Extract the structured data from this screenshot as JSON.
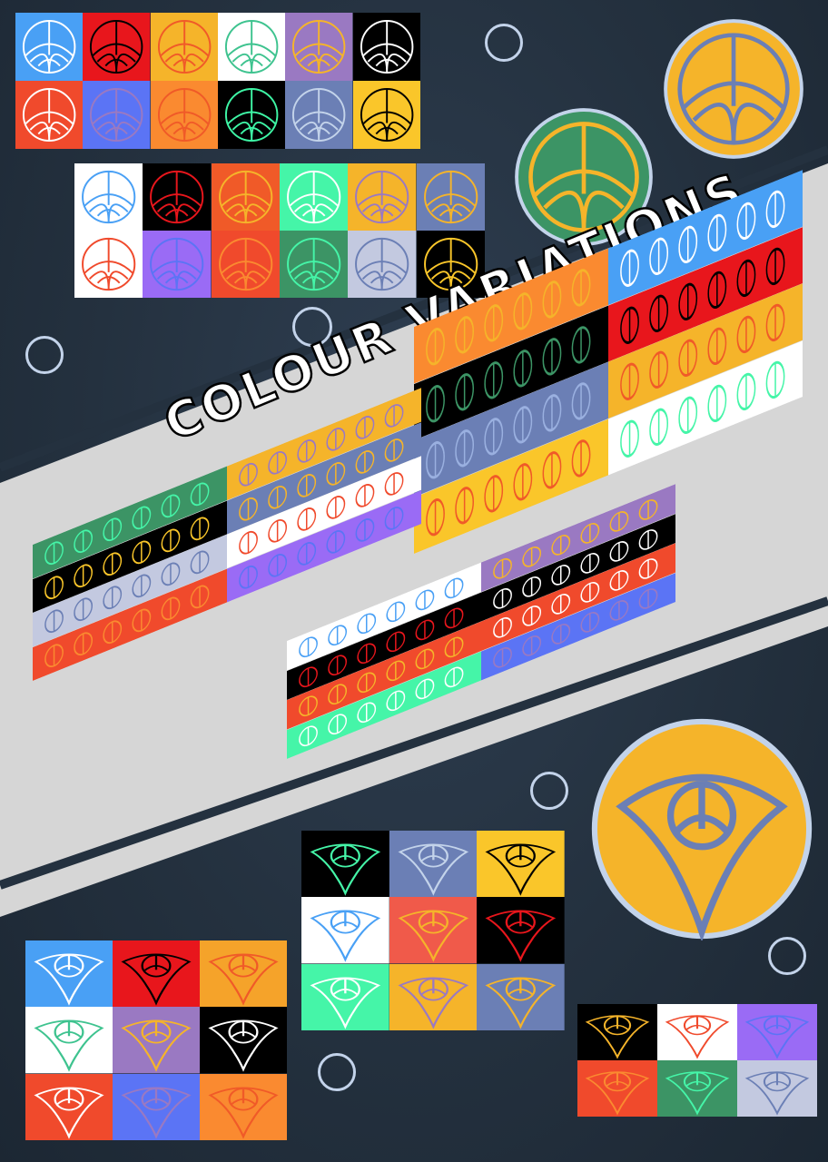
{
  "title": "COLOUR VARIATIONS",
  "colors": {
    "background": "#24313f",
    "diagonal_band": "#d6d6d6",
    "stripe": "#ffffff",
    "ring_outline": "#c3d3ea"
  },
  "icon_names": {
    "emblem": "peace-arch-emblem-icon",
    "fan": "fan-emblem-icon",
    "wordmark": "stylized-wordmark"
  },
  "circle_emblems": [
    {
      "fill": "#3c9465",
      "line": "#f5b42a",
      "border": "#c3d3ea"
    },
    {
      "fill": "#f5b42a",
      "line": "#6b7fb5",
      "border": "#c3d3ea"
    },
    {
      "fill": "#f5b42a",
      "line": "#6b7fb5",
      "border": "#c3d3ea"
    }
  ],
  "emblem_grid_top": [
    [
      "#49a0f5",
      "#ffffff"
    ],
    [
      "#e8161c",
      "#000000"
    ],
    [
      "#f5b42a",
      "#f05a28"
    ],
    [
      "#ffffff",
      "#3ec38f"
    ],
    [
      "#9a79c2",
      "#f5b42a"
    ],
    [
      "#000000",
      "#ffffff"
    ],
    [
      "#f04a2c",
      "#ffffff"
    ],
    [
      "#5b74f5",
      "#9a79c2"
    ],
    [
      "#fa8a30",
      "#f05a28"
    ],
    [
      "#000000",
      "#3ef5a5"
    ],
    [
      "#6b7fb5",
      "#c3d3ea"
    ],
    [
      "#fac62a",
      "#000000"
    ]
  ],
  "emblem_grid_second": [
    [
      "#ffffff",
      "#49a0f5"
    ],
    [
      "#000000",
      "#e8161c"
    ],
    [
      "#f05a28",
      "#f5b42a"
    ],
    [
      "#45f5a8",
      "#ffffff"
    ],
    [
      "#f5b42a",
      "#9a79c2"
    ],
    [
      "#6b7fb5",
      "#f5b42a"
    ],
    [
      "#ffffff",
      "#f04a2c"
    ],
    [
      "#9a6bf5",
      "#5b74f5"
    ],
    [
      "#f04a2c",
      "#fa8a30"
    ],
    [
      "#3c9465",
      "#45f5a8"
    ],
    [
      "#c3c9e0",
      "#6b7fb5"
    ],
    [
      "#000000",
      "#fac62a"
    ]
  ],
  "fan_grid_center": [
    [
      "#000000",
      "#45f5a8"
    ],
    [
      "#6b7fb5",
      "#c3d3ea"
    ],
    [
      "#fac62a",
      "#000000"
    ],
    [
      "#ffffff",
      "#49a0f5"
    ],
    [
      "#f05a4a",
      "#f5b42a"
    ],
    [
      "#000000",
      "#e8161c"
    ],
    [
      "#45f5a8",
      "#ffffff"
    ],
    [
      "#f5b42a",
      "#9a79c2"
    ],
    [
      "#6b7fb5",
      "#f5b42a"
    ]
  ],
  "fan_grid_left": [
    [
      "#49a0f5",
      "#ffffff"
    ],
    [
      "#e8161c",
      "#000000"
    ],
    [
      "#f5a32a",
      "#f05a28"
    ],
    [
      "#ffffff",
      "#3ec38f"
    ],
    [
      "#9a79c2",
      "#f5b42a"
    ],
    [
      "#000000",
      "#ffffff"
    ],
    [
      "#f04a2c",
      "#ffffff"
    ],
    [
      "#5b74f5",
      "#9a79c2"
    ],
    [
      "#fa8a30",
      "#f05a28"
    ]
  ],
  "fan_grid_right": [
    [
      "#000000",
      "#f5b42a"
    ],
    [
      "#ffffff",
      "#f04a2c"
    ],
    [
      "#9a6bf5",
      "#5b74f5"
    ],
    [
      "#f04a2c",
      "#fa8a30"
    ],
    [
      "#3c9465",
      "#45f5a8"
    ],
    [
      "#c3c9e0",
      "#6b7fb5"
    ]
  ],
  "wordmark_blocks": [
    {
      "strips": [
        [
          "#fa8a30",
          "#f5b42a"
        ],
        [
          "#000000",
          "#3c9465"
        ],
        [
          "#6b7fb5",
          "#9ab0e0"
        ],
        [
          "#fac62a",
          "#f05a28"
        ],
        [
          "#49a0f5",
          "#ffffff"
        ],
        [
          "#e8161c",
          "#000000"
        ],
        [
          "#f5b42a",
          "#f05a28"
        ],
        [
          "#ffffff",
          "#45f5a8"
        ]
      ]
    },
    {
      "strips": [
        [
          "#3c9465",
          "#45f5a8"
        ],
        [
          "#000000",
          "#fac62a"
        ],
        [
          "#c3c9e0",
          "#6b7fb5"
        ],
        [
          "#f04a2c",
          "#fa8a30"
        ],
        [
          "#f5b42a",
          "#9a79c2"
        ],
        [
          "#6b7fb5",
          "#f5b42a"
        ],
        [
          "#ffffff",
          "#f04a2c"
        ],
        [
          "#9a6bf5",
          "#5b74f5"
        ]
      ]
    },
    {
      "strips": [
        [
          "#ffffff",
          "#49a0f5"
        ],
        [
          "#000000",
          "#e8161c"
        ],
        [
          "#f04a2c",
          "#f5b42a"
        ],
        [
          "#45f5a8",
          "#ffffff"
        ],
        [
          "#9a79c2",
          "#f5b42a"
        ],
        [
          "#000000",
          "#ffffff"
        ],
        [
          "#f04a2c",
          "#ffffff"
        ],
        [
          "#5b74f5",
          "#9a79c2"
        ]
      ]
    }
  ]
}
